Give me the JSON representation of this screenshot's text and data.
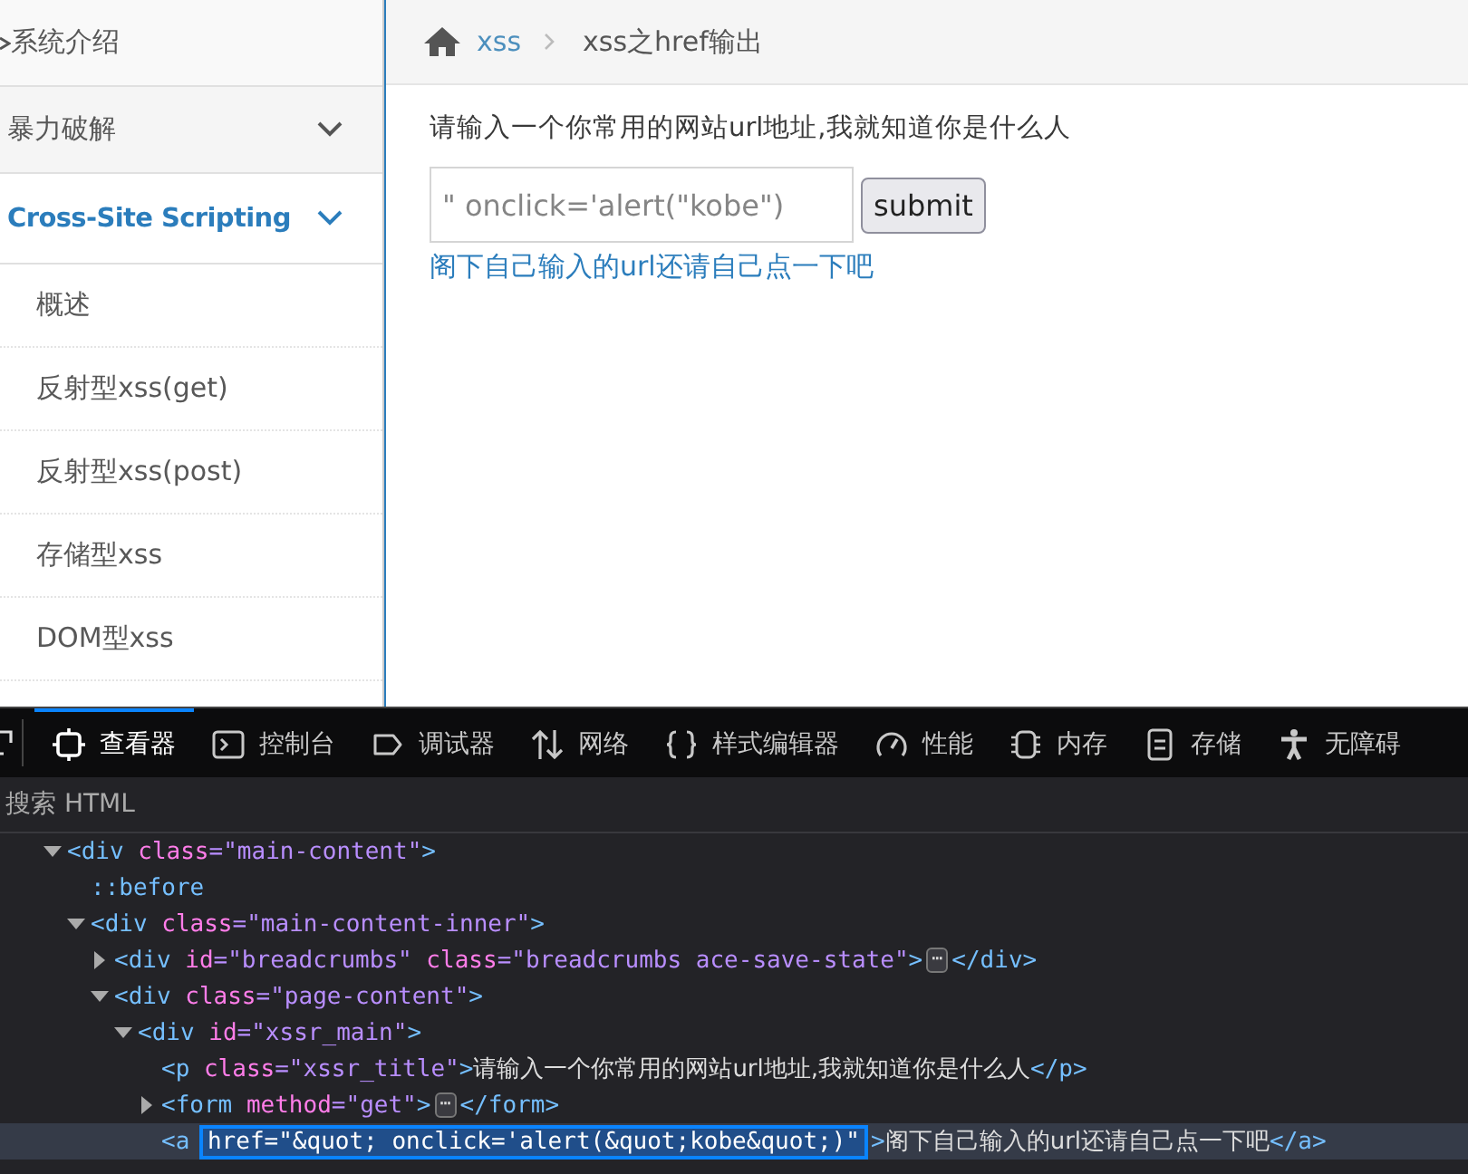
{
  "sidebar": {
    "items": [
      {
        "label": "系统介绍",
        "kind": "link",
        "selected": false
      },
      {
        "label": "暴力破解",
        "kind": "section",
        "selected": false
      },
      {
        "label": "Cross-Site Scripting",
        "kind": "section",
        "selected": true,
        "expanded": true,
        "children": [
          {
            "label": "概述",
            "selected": false
          },
          {
            "label": "反射型xss(get)",
            "selected": false
          },
          {
            "label": "反射型xss(post)",
            "selected": false
          },
          {
            "label": "存储型xss",
            "selected": false
          },
          {
            "label": "DOM型xss",
            "selected": false
          }
        ]
      }
    ]
  },
  "breadcrumbs": [
    {
      "label": "xss",
      "kind": "link"
    },
    {
      "label": "xss之href输出",
      "kind": "current"
    }
  ],
  "page": {
    "title": "请输入一个你常用的网站url地址,我就知道你是什么人",
    "input": {
      "value": "\" onclick='alert(\"kobe\")"
    },
    "submit": "submit",
    "link": "阁下自己输入的url还请自己点一下吧"
  },
  "devtools": {
    "tabs": [
      {
        "label": "查看器",
        "selected": true
      },
      {
        "label": "控制台",
        "selected": false
      },
      {
        "label": "调试器",
        "selected": false
      },
      {
        "label": "网络",
        "selected": false
      },
      {
        "label": "样式编辑器",
        "selected": false
      },
      {
        "label": "性能",
        "selected": false
      },
      {
        "label": "内存",
        "selected": false
      },
      {
        "label": "存储",
        "selected": false
      },
      {
        "label": "无障碍",
        "selected": false
      }
    ],
    "search": {
      "placeholder": "搜索 HTML"
    },
    "tree": [
      {
        "selected": false,
        "expanded": true,
        "tokens": [
          {
            "kind": "tag",
            "text": "<div"
          },
          {
            "kind": "attr",
            "text": "class"
          },
          {
            "kind": "value",
            "text": "=\"main-content\""
          },
          {
            "kind": "tag",
            "text": ">"
          }
        ],
        "children": [
          {
            "selected": false,
            "tokens": [
              {
                "kind": "pseudo",
                "text": "::before"
              }
            ]
          },
          {
            "selected": false,
            "expanded": true,
            "tokens": [
              {
                "kind": "tag",
                "text": "<div"
              },
              {
                "kind": "attr",
                "text": "class"
              },
              {
                "kind": "value",
                "text": "=\"main-content-inner\""
              },
              {
                "kind": "tag",
                "text": ">"
              }
            ],
            "children": [
              {
                "selected": false,
                "expanded": false,
                "tokens": [
                  {
                    "kind": "tag",
                    "text": "<div"
                  },
                  {
                    "kind": "attr",
                    "text": "id"
                  },
                  {
                    "kind": "value",
                    "text": "=\"breadcrumbs\""
                  },
                  {
                    "kind": "attr",
                    "text": "class"
                  },
                  {
                    "kind": "value",
                    "text": "=\"breadcrumbs ace-save-state\""
                  },
                  {
                    "kind": "tag",
                    "text": ">"
                  },
                  {
                    "kind": "badge",
                    "text": "⋯"
                  },
                  {
                    "kind": "tag",
                    "text": "</div>"
                  }
                ]
              },
              {
                "selected": false,
                "expanded": true,
                "tokens": [
                  {
                    "kind": "tag",
                    "text": "<div"
                  },
                  {
                    "kind": "attr",
                    "text": "class"
                  },
                  {
                    "kind": "value",
                    "text": "=\"page-content\""
                  },
                  {
                    "kind": "tag",
                    "text": ">"
                  }
                ],
                "children": [
                  {
                    "selected": false,
                    "expanded": true,
                    "tokens": [
                      {
                        "kind": "tag",
                        "text": "<div"
                      },
                      {
                        "kind": "attr",
                        "text": "id"
                      },
                      {
                        "kind": "value",
                        "text": "=\"xssr_main\""
                      },
                      {
                        "kind": "tag",
                        "text": ">"
                      }
                    ],
                    "children": [
                      {
                        "selected": false,
                        "tokens": [
                          {
                            "kind": "tag",
                            "text": "<p"
                          },
                          {
                            "kind": "attr",
                            "text": "class"
                          },
                          {
                            "kind": "value",
                            "text": "=\"xssr_title\""
                          },
                          {
                            "kind": "tag",
                            "text": ">"
                          },
                          {
                            "kind": "text",
                            "text": "请输入一个你常用的网站url地址,我就知道你是什么人"
                          },
                          {
                            "kind": "tag",
                            "text": "</p>"
                          }
                        ]
                      },
                      {
                        "selected": false,
                        "expanded": false,
                        "tokens": [
                          {
                            "kind": "tag",
                            "text": "<form"
                          },
                          {
                            "kind": "attr",
                            "text": "method"
                          },
                          {
                            "kind": "value",
                            "text": "=\"get\""
                          },
                          {
                            "kind": "tag",
                            "text": ">"
                          },
                          {
                            "kind": "badge",
                            "text": "⋯"
                          },
                          {
                            "kind": "tag",
                            "text": "</form>"
                          }
                        ]
                      },
                      {
                        "selected": true,
                        "tokens": [
                          {
                            "kind": "tag",
                            "text": "<a"
                          },
                          {
                            "kind": "highlight",
                            "text": "href=\"&quot; onclick='alert(&quot;kobe&quot;)\""
                          },
                          {
                            "kind": "tag",
                            "text": ">"
                          },
                          {
                            "kind": "text",
                            "text": "阁下自己输入的url还请自己点一下吧"
                          },
                          {
                            "kind": "tag",
                            "text": "</a>"
                          }
                        ]
                      }
                    ]
                  }
                ]
              }
            ]
          }
        ]
      }
    ]
  }
}
